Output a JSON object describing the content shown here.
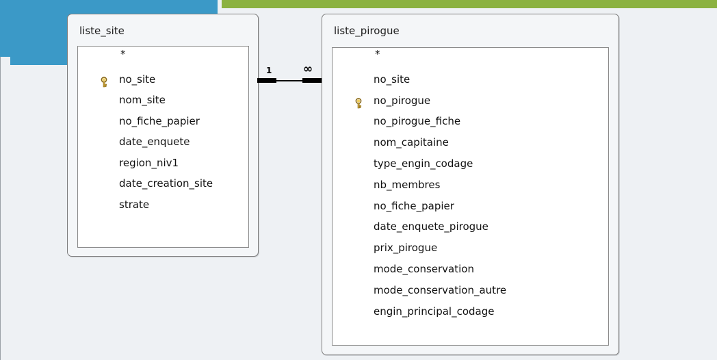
{
  "tables": [
    {
      "title": "liste_site",
      "fields": [
        {
          "name": "*",
          "key": false
        },
        {
          "name": "no_site",
          "key": true
        },
        {
          "name": "nom_site",
          "key": false
        },
        {
          "name": "no_fiche_papier",
          "key": false
        },
        {
          "name": "date_enquete",
          "key": false
        },
        {
          "name": "region_niv1",
          "key": false
        },
        {
          "name": "date_creation_site",
          "key": false
        },
        {
          "name": "strate",
          "key": false
        }
      ]
    },
    {
      "title": "liste_pirogue",
      "fields": [
        {
          "name": "*",
          "key": false
        },
        {
          "name": "no_site",
          "key": false
        },
        {
          "name": "no_pirogue",
          "key": true
        },
        {
          "name": "no_pirogue_fiche",
          "key": false
        },
        {
          "name": "nom_capitaine",
          "key": false
        },
        {
          "name": "type_engin_codage",
          "key": false
        },
        {
          "name": "nb_membres",
          "key": false
        },
        {
          "name": "no_fiche_papier",
          "key": false
        },
        {
          "name": "date_enquete_pirogue",
          "key": false
        },
        {
          "name": "prix_pirogue",
          "key": false
        },
        {
          "name": "mode_conservation",
          "key": false
        },
        {
          "name": "mode_conservation_autre",
          "key": false
        },
        {
          "name": "engin_principal_codage",
          "key": false
        }
      ]
    }
  ],
  "relationship": {
    "one_label": "1",
    "many_label": "∞"
  },
  "icons": {
    "primary_key": "key-icon"
  },
  "colors": {
    "accent_blue": "#3b99c7",
    "accent_green": "#8bb240",
    "key_gold": "#c8a23a"
  }
}
